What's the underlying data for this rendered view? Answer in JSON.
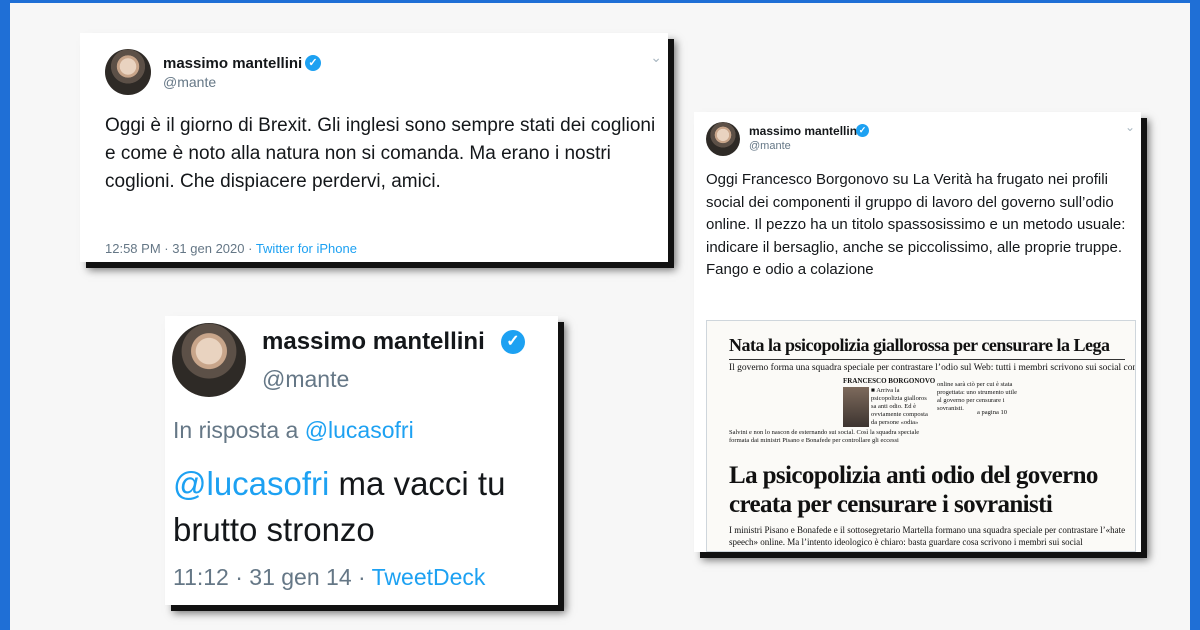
{
  "colors": {
    "frame": "#1f6fd6",
    "link": "#1da1f2",
    "verified": "#1da1f2"
  },
  "tweet1": {
    "name": "massimo mantellini",
    "handle": "@mante",
    "verified_icon": "✓",
    "chevron_icon": "⌄",
    "text": "Oggi è il giorno di Brexit. Gli inglesi sono sempre stati dei coglioni e come è noto alla natura non si comanda. Ma erano i nostri coglioni. Che dispiacere perdervi, amici.",
    "time": "12:58 PM · 31 gen 2020 · ",
    "source": "Twitter for iPhone"
  },
  "tweet2": {
    "name": "massimo mantellini",
    "handle": "@mante",
    "verified_icon": "✓",
    "chevron_icon": "⌄",
    "text": "Oggi Francesco Borgonovo su La Verità ha frugato nei profili social dei componenti il gruppo di lavoro del governo sull’odio online. Il pezzo ha un titolo spassosissimo e un metodo usuale: indicare il bersaglio, anche se piccolissimo, alle proprie truppe. Fango e odio a colazione",
    "clipping": {
      "headline": "Nata la psicopolizia giallorossa per censurare la Lega",
      "subheadline": "Il governo forma una squadra speciale per contrastare l’odio sul Web: tutti i membri scrivono sui social contro Salvini",
      "author": "FRANCESCO BORGONOVO",
      "col1": "■ Arriva la psicopolizia gialloros sa anti odio. Ed è ovviamente composta da persone «odia»",
      "col0": "Salvini e non lo nascon de esternando sui social. Così la squadra speciale formata dai ministri Pisano e Bonafede per controllare gli eccessi",
      "col2": "online sarà ciò per cui è stata progettata: uno strumento utile al governo per censurare i sovranisti.",
      "page_ref": "a pagina 10",
      "big_headline": "La psicopolizia anti odio del governo creata per censurare i sovranisti",
      "footer": "I ministri Pisano e Bonafede e il sottosegretario Martella formano una squadra speciale per contrastare l’«hate speech» online. Ma l’intento ideologico è chiaro: basta guardare cosa scrivono i membri sui social"
    }
  },
  "tweet3": {
    "name": "massimo mantellini",
    "handle": "@mante",
    "verified_icon": "✓",
    "reply_prefix": "In risposta a ",
    "reply_to": "@lucasofri",
    "mention": "@lucasofri",
    "text_line1": " ma vacci tu",
    "text_line2": "brutto stronzo",
    "time": "11:12 · 31 gen 14 · ",
    "source": "TweetDeck"
  }
}
